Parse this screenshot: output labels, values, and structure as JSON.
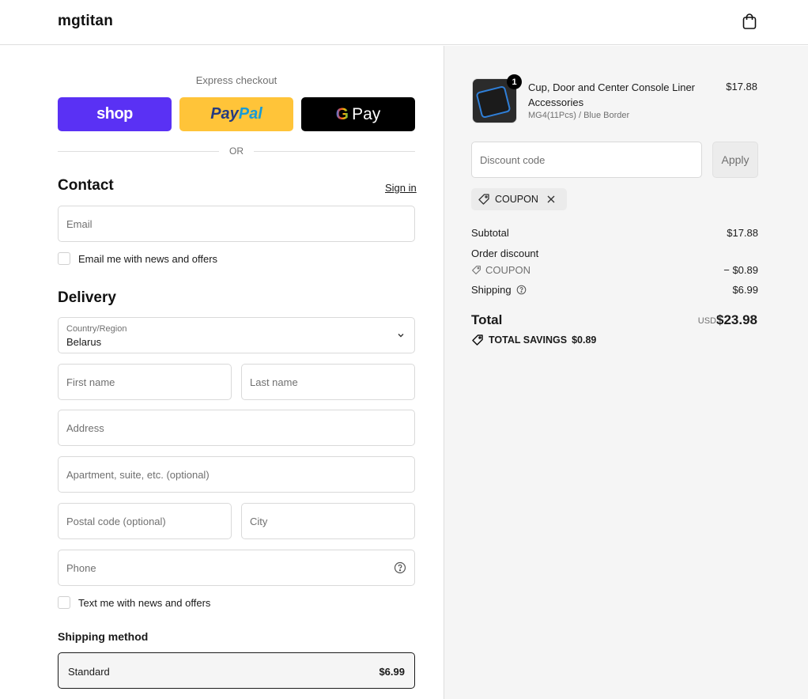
{
  "header": {
    "brand": "mgtitan",
    "cart_icon": "shopping-bag-icon"
  },
  "express": {
    "title": "Express checkout",
    "shop_label": "shop",
    "paypal_part1": "Pay",
    "paypal_part2": "Pal",
    "gpay_g": "G",
    "gpay_label": "Pay",
    "or": "OR"
  },
  "contact": {
    "title": "Contact",
    "sign_in": "Sign in",
    "email_placeholder": "Email",
    "email_opt_in": "Email me with news and offers"
  },
  "delivery": {
    "title": "Delivery",
    "country_label": "Country/Region",
    "country_value": "Belarus",
    "first_name": "First name",
    "last_name": "Last name",
    "address": "Address",
    "apartment": "Apartment, suite, etc. (optional)",
    "postal": "Postal code (optional)",
    "city": "City",
    "phone": "Phone",
    "sms_opt_in": "Text me with news and offers"
  },
  "shipping": {
    "title": "Shipping method",
    "option_name": "Standard",
    "option_price": "$6.99"
  },
  "summary": {
    "product": {
      "quantity": "1",
      "name": "Cup, Door and Center Console Liner Accessories",
      "variant": "MG4(11Pcs)   / Blue Border",
      "price": "$17.88"
    },
    "discount_placeholder": "Discount code",
    "apply": "Apply",
    "coupon_code": "COUPON",
    "subtotal_label": "Subtotal",
    "subtotal_value": "$17.88",
    "order_discount_label": "Order discount",
    "order_discount_code": "COUPON",
    "order_discount_value": "− $0.89",
    "shipping_label": "Shipping",
    "shipping_value": "$6.99",
    "total_label": "Total",
    "total_currency": "USD",
    "total_value": "$23.98",
    "savings_label": "TOTAL SAVINGS",
    "savings_value": "$0.89"
  }
}
